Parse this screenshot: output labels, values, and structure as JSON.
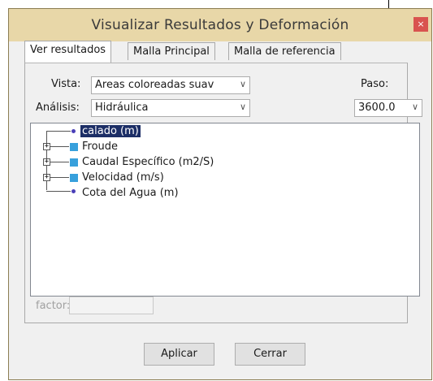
{
  "window": {
    "title": "Visualizar Resultados y Deformación",
    "close_glyph": "×"
  },
  "tabs": [
    {
      "label": "Ver resultados",
      "active": true
    },
    {
      "label": "Malla Principal",
      "active": false
    },
    {
      "label": "Malla de referencia",
      "active": false
    }
  ],
  "form": {
    "vista_label": "Vista:",
    "vista_value": "Areas coloreadas suav",
    "analisis_label": "Análisis:",
    "analisis_value": "Hidráulica",
    "paso_label": "Paso:",
    "paso_value": "3600.0",
    "chevron": "∨"
  },
  "tree": [
    {
      "label": "calado (m)",
      "icon": "dot",
      "expandable": false,
      "selected": true
    },
    {
      "label": "Froude",
      "icon": "square",
      "expandable": true,
      "selected": false
    },
    {
      "label": "Caudal Específico (m2/S)",
      "icon": "square",
      "expandable": true,
      "selected": false
    },
    {
      "label": "Velocidad (m/s)",
      "icon": "square",
      "expandable": true,
      "selected": false
    },
    {
      "label": "Cota del Agua (m)",
      "icon": "dot",
      "expandable": false,
      "selected": false
    }
  ],
  "factor": {
    "label": "factor:",
    "value": ""
  },
  "buttons": {
    "apply": "Aplicar",
    "close": "Cerrar"
  },
  "colors": {
    "titlebar": "#e8d7a8",
    "selection": "#1c2e66",
    "close": "#d9534f"
  }
}
